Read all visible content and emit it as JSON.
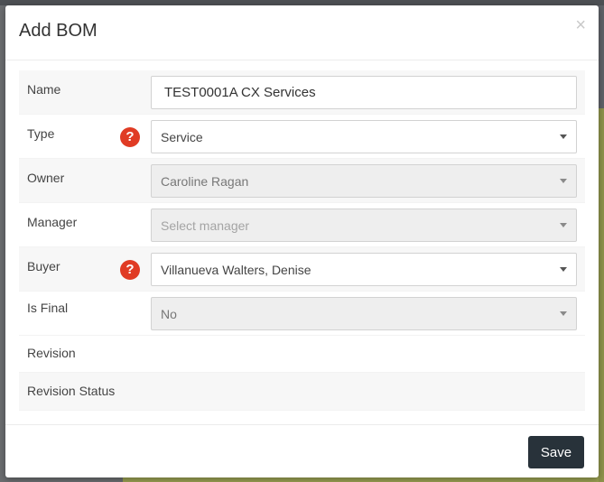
{
  "modal": {
    "title": "Add BOM",
    "close_glyph": "×"
  },
  "form": {
    "name": {
      "label": "Name",
      "value": "TEST0001A CX Services"
    },
    "type": {
      "label": "Type",
      "value": "Service",
      "help_glyph": "?"
    },
    "owner": {
      "label": "Owner",
      "value": "Caroline Ragan"
    },
    "manager": {
      "label": "Manager",
      "placeholder": "Select manager"
    },
    "buyer": {
      "label": "Buyer",
      "value": "Villanueva Walters, Denise",
      "help_glyph": "?"
    },
    "is_final": {
      "label": "Is Final",
      "value": "No"
    },
    "revision": {
      "label": "Revision"
    },
    "revision_status": {
      "label": "Revision Status"
    }
  },
  "footer": {
    "save_label": "Save"
  },
  "colors": {
    "help_icon": "#e03b24",
    "save_button": "#28323a",
    "backdrop": "#6f7173",
    "background_accent": "#9aa052"
  },
  "icons": {
    "help": "question-circle-icon",
    "dropdown": "caret-down-icon",
    "close": "close-icon"
  }
}
